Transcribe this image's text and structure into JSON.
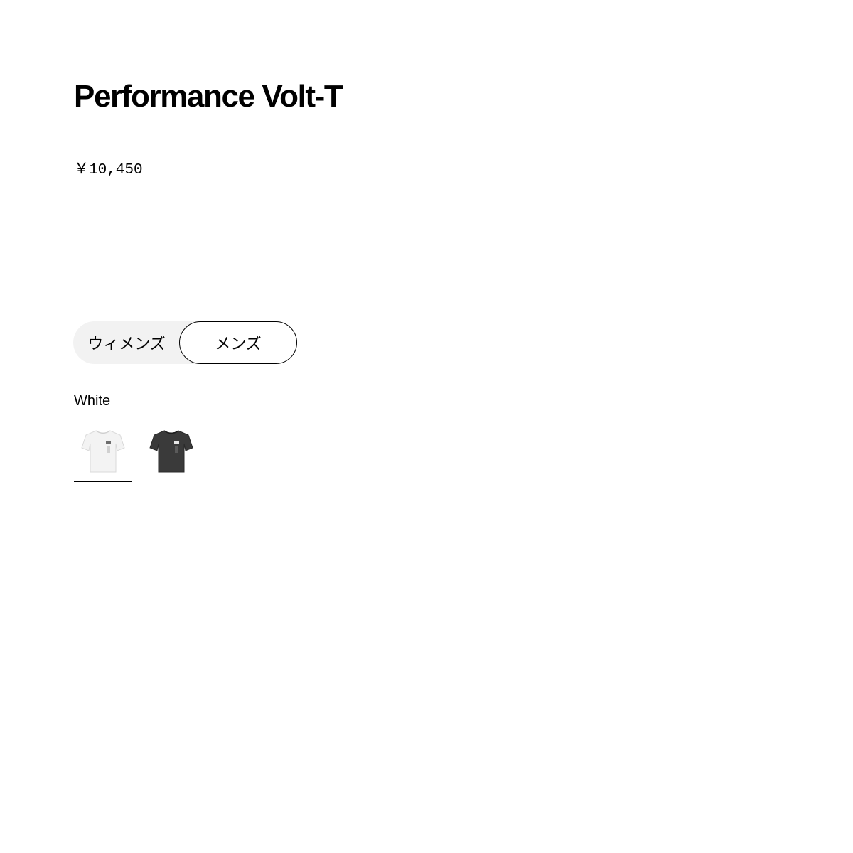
{
  "product": {
    "title": "Performance Volt-T",
    "price": "￥10,450"
  },
  "gender_toggle": {
    "options": [
      {
        "label": "ウィメンズ",
        "selected": false
      },
      {
        "label": "メンズ",
        "selected": true
      }
    ]
  },
  "color": {
    "selected_name": "White",
    "swatches": [
      {
        "icon": "white-tshirt-thumbnail",
        "color": "#f3f3f3",
        "selected": true
      },
      {
        "icon": "charcoal-tshirt-thumbnail",
        "color": "#3a3a3a",
        "selected": false
      }
    ]
  }
}
